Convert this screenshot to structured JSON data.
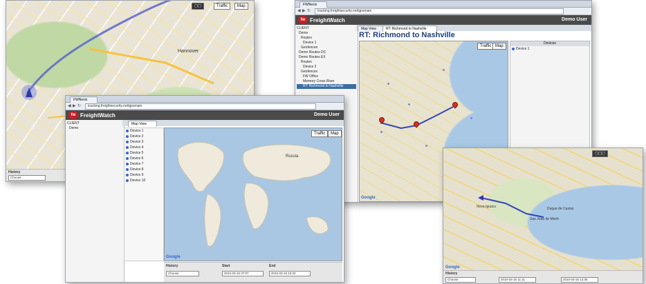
{
  "shot_a": {
    "map_type": "Map",
    "traffic": "Traffic",
    "city": "Hannover",
    "history_label": "History",
    "history_select": "Choose"
  },
  "shot_b": {
    "window_title": "FWNexis",
    "url": "tracking.freightsecurity.net/gpsmain",
    "brand_fw": "fw",
    "brand_name": "FreightWatch",
    "user": "Demo User",
    "tree": [
      "CLIENT",
      "Demo"
    ],
    "tab": "Map View",
    "traffic": "Traffic",
    "map_type": "Map",
    "devices": [
      "Device 1",
      "Device 2",
      "Device 3",
      "Device 4",
      "Device 5",
      "Device 6",
      "Device 7",
      "Device 8",
      "Device 9",
      "Device 10"
    ],
    "history_label": "History",
    "history_select": "Choose",
    "start_label": "Start",
    "start_value": "2010-03-15 07:07",
    "end_label": "End",
    "end_value": "2010-03-15 10:20",
    "place_russia": "Russia",
    "google": "Google"
  },
  "shot_c": {
    "window_title": "FWNexis",
    "url": "tracking.freightsecurity.net/gpsmain",
    "brand_fw": "fw",
    "brand_name": "FreightWatch",
    "user": "Demo User",
    "tree": [
      "CLIENT",
      "Demo",
      "Routes",
      "Device 1",
      "Geofences",
      "Demo Routes DC",
      "Demo Routes EX",
      "Routes",
      "Device 2",
      "Geofences",
      "FW Office",
      "Memory Cross River",
      "RT: Richmond to Nashville"
    ],
    "tabs": [
      "Map View",
      "RT: Richmond to Nashville"
    ],
    "title": "RT: Richmond to Nashville",
    "traffic": "Traffic",
    "map_type": "Map",
    "devices_header": "Devices",
    "device": "Device 1",
    "google": "Google"
  },
  "shot_d": {
    "places": [
      "Nova Iguacu",
      "Duque de Caxias",
      "Sao Joao de Meriti"
    ],
    "history_label": "History",
    "history_select": "Choose",
    "start_value": "2010-03-15 11:11",
    "end_value": "2010-03-15 13:35",
    "google": "Google"
  }
}
